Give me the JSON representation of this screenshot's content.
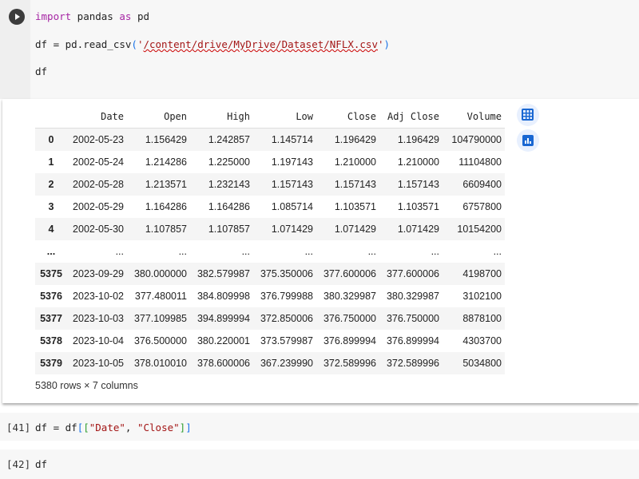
{
  "cell1": {
    "line1": {
      "kw1": "import",
      "mid": " pandas ",
      "kw2": "as",
      "end": " pd"
    },
    "line2": {
      "pre": "df = pd.read_csv",
      "open": "(",
      "q1": "'",
      "path": "/content/drive/MyDrive/Dataset/NFLX.csv",
      "q2": "'",
      "close": ")"
    },
    "line3": "df"
  },
  "output": {
    "columns": [
      "",
      "Date",
      "Open",
      "High",
      "Low",
      "Close",
      "Adj Close",
      "Volume"
    ],
    "rows": [
      [
        "0",
        "2002-05-23",
        "1.156429",
        "1.242857",
        "1.145714",
        "1.196429",
        "1.196429",
        "104790000"
      ],
      [
        "1",
        "2002-05-24",
        "1.214286",
        "1.225000",
        "1.197143",
        "1.210000",
        "1.210000",
        "11104800"
      ],
      [
        "2",
        "2002-05-28",
        "1.213571",
        "1.232143",
        "1.157143",
        "1.157143",
        "1.157143",
        "6609400"
      ],
      [
        "3",
        "2002-05-29",
        "1.164286",
        "1.164286",
        "1.085714",
        "1.103571",
        "1.103571",
        "6757800"
      ],
      [
        "4",
        "2002-05-30",
        "1.107857",
        "1.107857",
        "1.071429",
        "1.071429",
        "1.071429",
        "10154200"
      ],
      [
        "...",
        "...",
        "...",
        "...",
        "...",
        "...",
        "...",
        "..."
      ],
      [
        "5375",
        "2023-09-29",
        "380.000000",
        "382.579987",
        "375.350006",
        "377.600006",
        "377.600006",
        "4198700"
      ],
      [
        "5376",
        "2023-10-02",
        "377.480011",
        "384.809998",
        "376.799988",
        "380.329987",
        "380.329987",
        "3102100"
      ],
      [
        "5377",
        "2023-10-03",
        "377.109985",
        "394.899994",
        "372.850006",
        "376.750000",
        "376.750000",
        "8878100"
      ],
      [
        "5378",
        "2023-10-04",
        "376.500000",
        "380.220001",
        "373.579987",
        "376.899994",
        "376.899994",
        "4303700"
      ],
      [
        "5379",
        "2023-10-05",
        "378.010010",
        "378.600006",
        "367.239990",
        "372.589996",
        "372.589996",
        "5034800"
      ]
    ],
    "footer": "5380 rows × 7 columns",
    "icons": [
      "table-icon",
      "chart-icon"
    ]
  },
  "cell41": {
    "num": "[41]",
    "pre": "df = df",
    "b1": "[",
    "b2": "[",
    "s1": "\"Date\"",
    "comma": ", ",
    "s2": "\"Close\"",
    "b3": "]",
    "b4": "]"
  },
  "cell42": {
    "num": "[42]",
    "code": "df"
  }
}
